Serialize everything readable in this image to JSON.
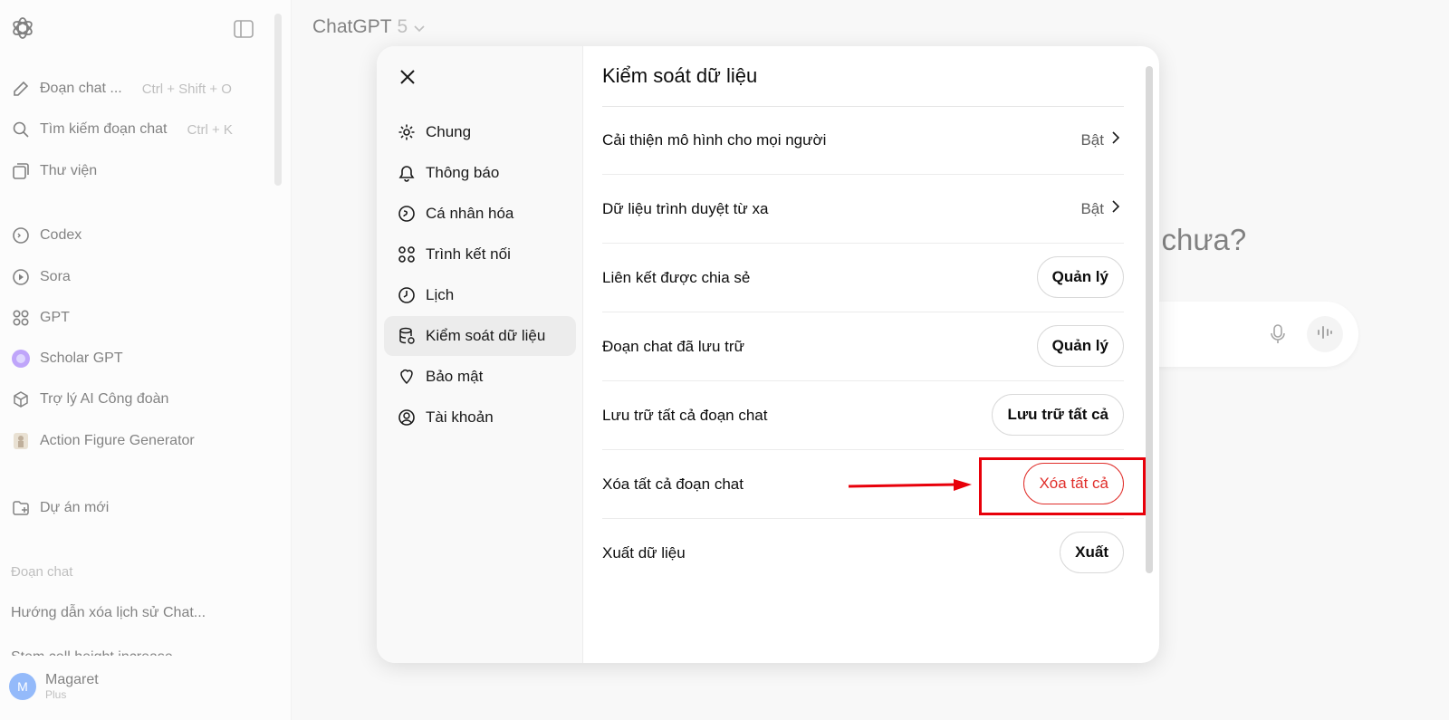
{
  "sidebar": {
    "new_chat": {
      "label": "Đoạn chat ...",
      "shortcut": "Ctrl + Shift + O"
    },
    "search": {
      "label": "Tìm kiếm đoạn chat",
      "shortcut": "Ctrl + K"
    },
    "library": {
      "label": "Thư viện"
    },
    "apps": [
      {
        "label": "Codex"
      },
      {
        "label": "Sora"
      },
      {
        "label": "GPT"
      },
      {
        "label": "Scholar GPT"
      },
      {
        "label": "Trợ lý AI Công đoàn"
      },
      {
        "label": "Action Figure Generator"
      }
    ],
    "new_project": "Dự án mới",
    "chats_heading": "Đoạn chat",
    "chats": [
      "Hướng dẫn xóa lịch sử Chat...",
      "Stem cell height increase"
    ],
    "user": {
      "initial": "M",
      "name": "Magaret",
      "plan": "Plus"
    }
  },
  "header": {
    "model": "ChatGPT",
    "version": "5"
  },
  "hero": {
    "question": "á chưa?"
  },
  "settings": {
    "nav": [
      {
        "label": "Chung",
        "icon": "gear-icon"
      },
      {
        "label": "Thông báo",
        "icon": "bell-icon"
      },
      {
        "label": "Cá nhân hóa",
        "icon": "personalize-icon"
      },
      {
        "label": "Trình kết nối",
        "icon": "connectors-icon"
      },
      {
        "label": "Lịch",
        "icon": "clock-icon"
      },
      {
        "label": "Kiểm soát dữ liệu",
        "icon": "database-icon"
      },
      {
        "label": "Bảo mật",
        "icon": "shield-icon"
      },
      {
        "label": "Tài khoản",
        "icon": "user-circle-icon"
      }
    ],
    "active": "Kiểm soát dữ liệu",
    "title": "Kiểm soát dữ liệu",
    "rows": [
      {
        "label": "Cải thiện mô hình cho mọi người",
        "value": "Bật"
      },
      {
        "label": "Dữ liệu trình duyệt từ xa",
        "value": "Bật"
      },
      {
        "label": "Liên kết được chia sẻ",
        "button": "Quản lý"
      },
      {
        "label": "Đoạn chat đã lưu trữ",
        "button": "Quản lý"
      },
      {
        "label": "Lưu trữ tất cả đoạn chat",
        "button": "Lưu trữ tất cả"
      },
      {
        "label": "Xóa tất cả đoạn chat",
        "button": "Xóa tất cả"
      },
      {
        "label": "Xuất dữ liệu",
        "button": "Xuất"
      }
    ]
  },
  "colors": {
    "danger": "#e02e2a",
    "annotation": "#e8000a",
    "avatar": "#3c82f6"
  }
}
